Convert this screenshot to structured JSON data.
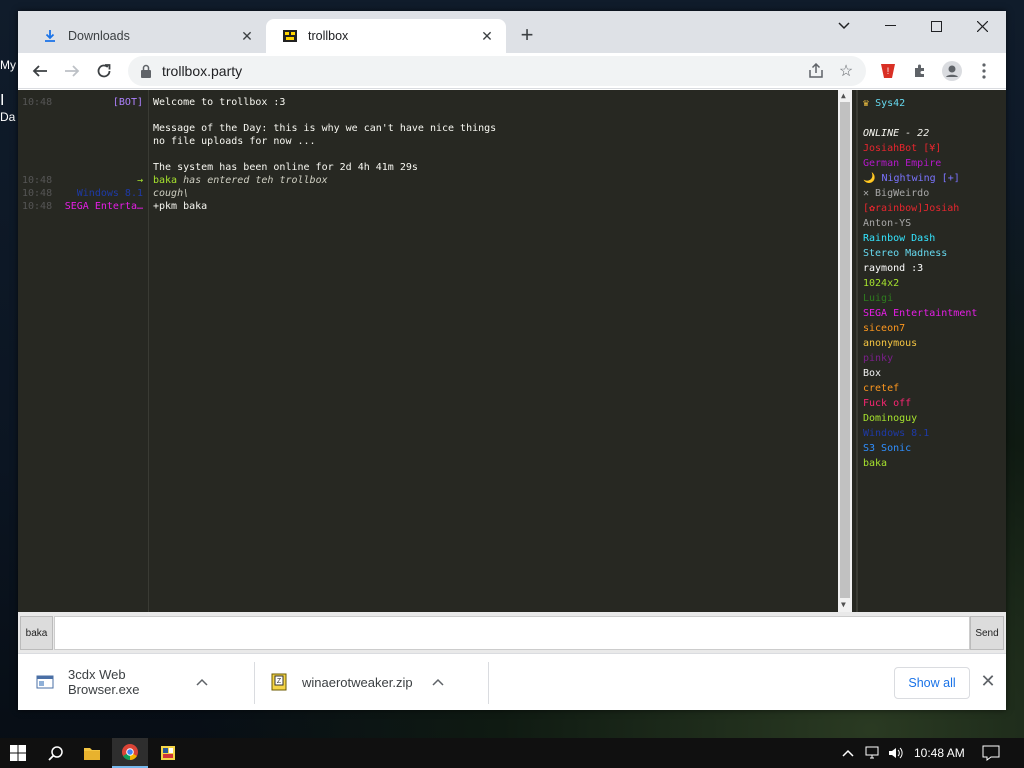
{
  "browser": {
    "tabs": [
      {
        "title": "Downloads",
        "icon": "download-icon",
        "active": false
      },
      {
        "title": "trollbox",
        "icon": "trollbox-favicon",
        "active": true
      }
    ],
    "url": "trollbox.party"
  },
  "chat": {
    "messages": [
      {
        "time": "10:48",
        "nick": "[BOT]",
        "nick_color": "#ae81ff",
        "text": "Welcome to trollbox :3",
        "text_color": "#f8f8f2",
        "italic": false
      },
      {
        "time": "",
        "nick": "",
        "nick_color": "#f8f8f2",
        "text": "Message of the Day: this is why we can't have nice things",
        "text_color": "#f8f8f2",
        "italic": false
      },
      {
        "time": "",
        "nick": "",
        "nick_color": "#f8f8f2",
        "text": "no file uploads for now ...",
        "text_color": "#f8f8f2",
        "italic": false
      },
      {
        "time": "",
        "nick": "",
        "nick_color": "#f8f8f2",
        "text": "The system has been online for 2d 4h 41m 29s",
        "text_color": "#f8f8f2",
        "italic": false
      },
      {
        "time": "10:48",
        "nick": "→",
        "nick_color": "#a6e22e",
        "text_prefix": "baka",
        "text": " has entered teh trollbox",
        "text_color": "#cfcfc2",
        "italic": true
      },
      {
        "time": "10:48",
        "nick": "Windows 8.1",
        "nick_color": "#1e3aa8",
        "text": "cough\\",
        "text_color": "#cfcfc2",
        "italic": true
      },
      {
        "time": "10:48",
        "nick": "SEGA Enterta…",
        "nick_color": "#e61ee6",
        "text": "+pkm baka",
        "text_color": "#f8f8f2",
        "italic": false
      }
    ],
    "input_nick": "baka",
    "input_value": "",
    "send_label": "Send"
  },
  "users": {
    "top": {
      "label": "Sys42",
      "color": "#66d9ef",
      "icon": "crown-icon"
    },
    "online_label": "ONLINE - 22",
    "list": [
      {
        "name": "JosiahBot [¥]",
        "color": "#e6262e"
      },
      {
        "name": "German Empire",
        "color": "#b319c9"
      },
      {
        "name": "🌙 Nightwing [+]",
        "color": "#7b74ff"
      },
      {
        "name": "✕ BigWeirdo",
        "color": "#a8a8a8"
      },
      {
        "name": "[✿rainbow]Josiah",
        "color": "#e6262e"
      },
      {
        "name": "Anton-YS",
        "color": "#a8a8a8"
      },
      {
        "name": "Rainbow Dash",
        "color": "#33e5ff"
      },
      {
        "name": "Stereo Madness",
        "color": "#66d9ef"
      },
      {
        "name": "raymond :3",
        "color": "#ffffff"
      },
      {
        "name": "1024x2",
        "color": "#a6e22e"
      },
      {
        "name": "Luigi",
        "color": "#2e7d1e"
      },
      {
        "name": "SEGA Entertaintment",
        "color": "#e61ee6"
      },
      {
        "name": "siceon7",
        "color": "#fd971f"
      },
      {
        "name": "anonymous",
        "color": "#f5c542"
      },
      {
        "name": "pinky",
        "color": "#7a1f8a"
      },
      {
        "name": "Box",
        "color": "#f2f2f2"
      },
      {
        "name": "cretef",
        "color": "#fd971f"
      },
      {
        "name": "Fuck off",
        "color": "#f92672"
      },
      {
        "name": "Dominoguy",
        "color": "#a6e22e"
      },
      {
        "name": "Windows 8.1",
        "color": "#1e3aa8"
      },
      {
        "name": "S3 Sonic",
        "color": "#2f8fff"
      },
      {
        "name": "baka",
        "color": "#a6e22e"
      }
    ]
  },
  "downloads": {
    "items": [
      {
        "name": "3cdx Web Browser.exe",
        "icon": "exe-file-icon"
      },
      {
        "name": "winaerotweaker.zip",
        "icon": "zip-file-icon"
      }
    ],
    "show_all": "Show all"
  },
  "taskbar": {
    "clock": "10:48 AM"
  },
  "desktop": {
    "icon_labels": [
      "My",
      "I",
      "Da"
    ]
  }
}
